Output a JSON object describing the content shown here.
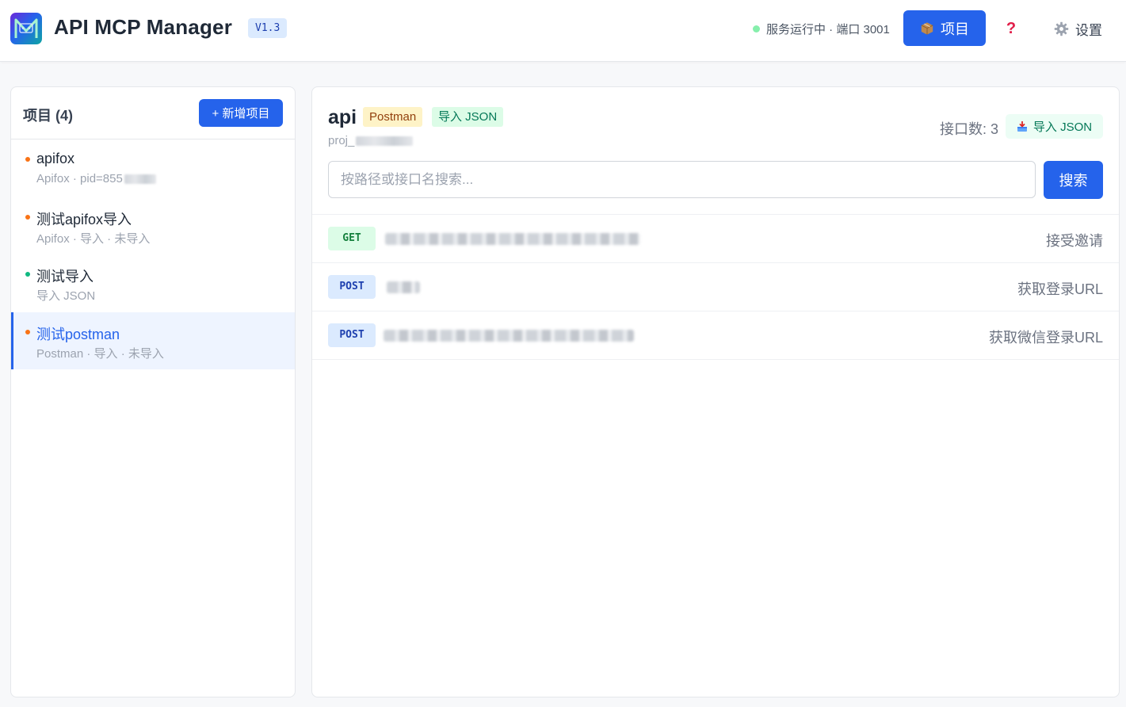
{
  "header": {
    "app_title": "API MCP Manager",
    "version": "V1.3",
    "status_text": "服务运行中 · 端口 3001",
    "projects_button": "项目",
    "help_label": "?",
    "settings_label": "设置",
    "colors": {
      "accent": "#2563eb",
      "status_ok": "#86efac"
    }
  },
  "sidebar": {
    "title": "项目 (4)",
    "add_button": "+ 新增项目",
    "projects": [
      {
        "name": "apifox",
        "meta": "Apifox · pid=855",
        "dot_color": "#f97316",
        "active": false
      },
      {
        "name": "测试apifox导入",
        "meta": "Apifox · 导入 · 未导入",
        "dot_color": "#f97316",
        "active": false
      },
      {
        "name": "测试导入",
        "meta": "导入 JSON",
        "dot_color": "#10b981",
        "active": false
      },
      {
        "name": "测试postman",
        "meta": "Postman · 导入 · 未导入",
        "dot_color": "#f97316",
        "active": true
      }
    ]
  },
  "main": {
    "project_title": "api",
    "tag_postman": "Postman",
    "tag_json": "导入 JSON",
    "project_id_prefix": "proj_",
    "endpoint_count": "接口数: 3",
    "import_json_button": "导入 JSON",
    "search_placeholder": "按路径或接口名搜索...",
    "search_button": "搜索",
    "endpoints": [
      {
        "method": "GET",
        "description": "接受邀请"
      },
      {
        "method": "POST",
        "description": "获取登录URL"
      },
      {
        "method": "POST",
        "description": "获取微信登录URL"
      }
    ]
  }
}
